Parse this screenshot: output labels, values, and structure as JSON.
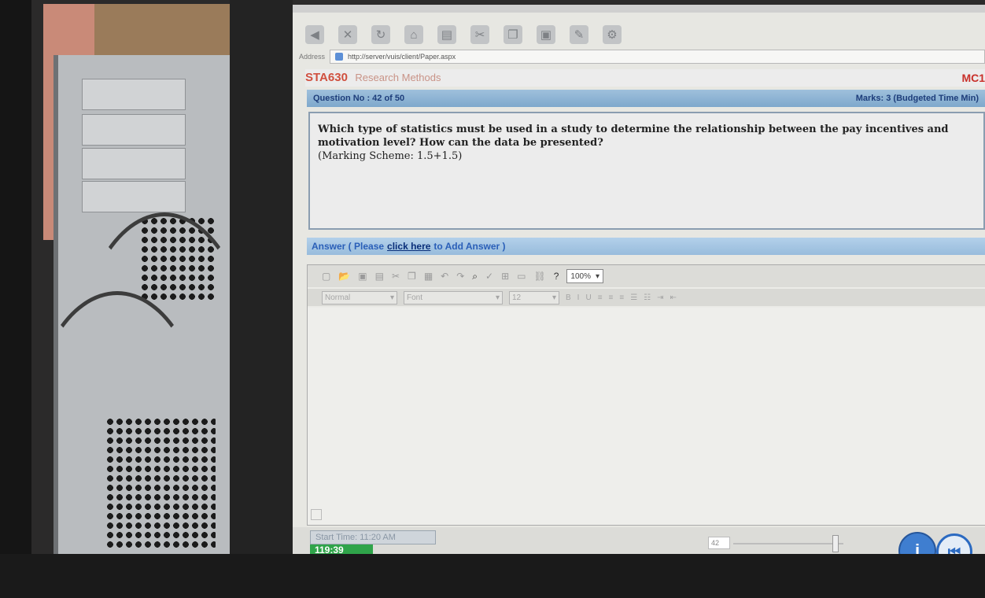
{
  "browser": {
    "address_label": "Address",
    "url": "http://server/vuis/client/Paper.aspx"
  },
  "course": {
    "code": "STA630",
    "name": "Research Methods",
    "paper_code": "MC1"
  },
  "question": {
    "number_label": "Question No : 42 of 50",
    "marks_label": "Marks: 3 (Budgeted Time Min)",
    "text": "Which type of statistics must be used in a study to determine the relationship between the pay incentives and motivation level? How can the data be presented?",
    "scheme": "(Marking Scheme: 1.5+1.5)"
  },
  "answer": {
    "label_prefix": "Answer ( Please",
    "link_text": "click here",
    "label_suffix": "to Add Answer )"
  },
  "editor": {
    "zoom": "100%",
    "font_placeholder": "Normal",
    "font_family": "Font",
    "font_size": "12"
  },
  "status": {
    "start_time": "Start Time: 11:20 AM",
    "timer": "119:39",
    "question_number": "42"
  }
}
